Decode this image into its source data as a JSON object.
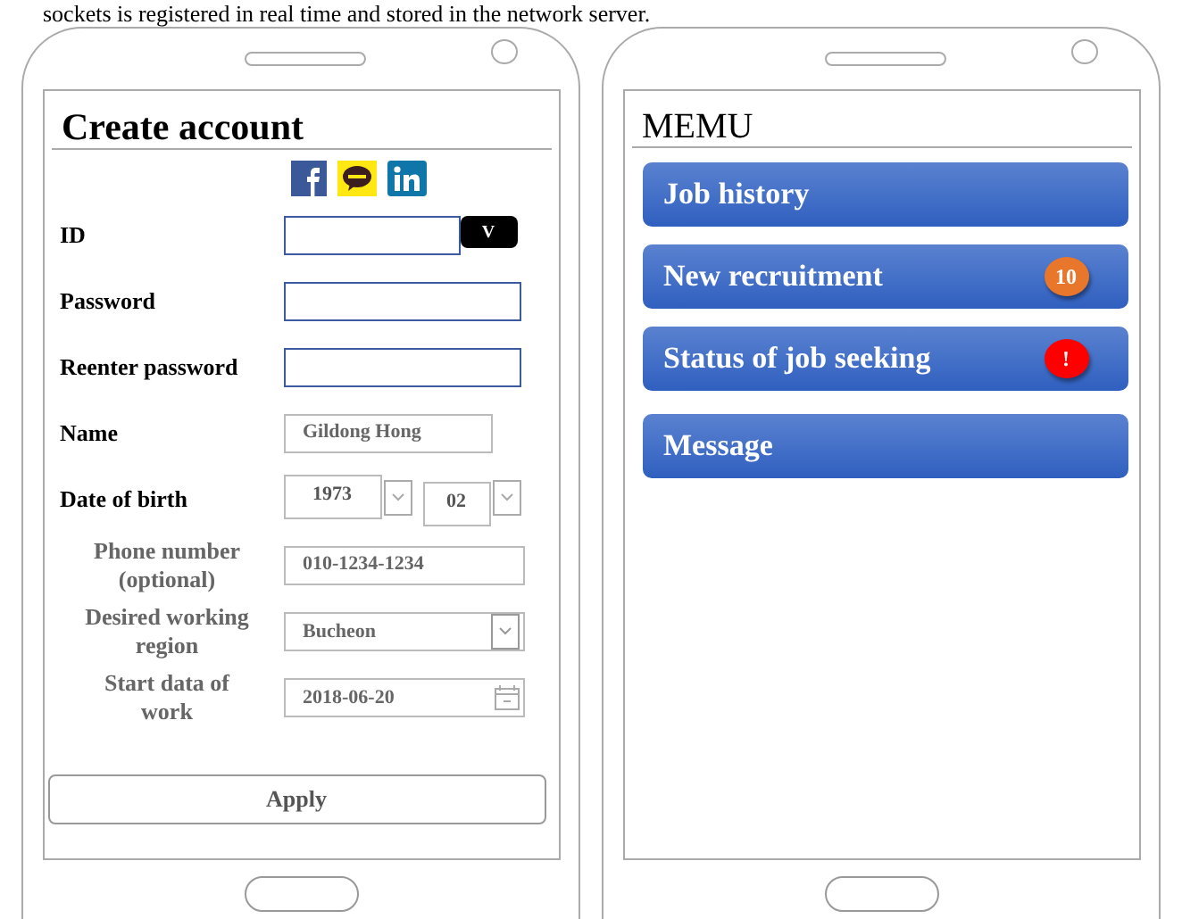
{
  "caption": "sockets is registered in real time and stored in the network server.",
  "signup": {
    "title": "Create account",
    "fields": [
      {
        "kind": "id",
        "label": "ID",
        "muted": false,
        "button": "V"
      },
      {
        "kind": "input",
        "label": "Password",
        "muted": false
      },
      {
        "kind": "input",
        "label": "Reenter password",
        "muted": false
      },
      {
        "kind": "value",
        "label": "Name",
        "muted": false,
        "value": "Gildong Hong"
      },
      {
        "kind": "pair",
        "label": "Date of birth",
        "muted": false,
        "selects": [
          "1973",
          "02"
        ]
      },
      {
        "kind": "value",
        "label": "Phone number (optional)",
        "muted": true,
        "value": "010-1234-1234"
      },
      {
        "kind": "select",
        "label": "Desired working region",
        "muted": true,
        "value": "Bucheon"
      },
      {
        "kind": "date",
        "label": "Start data of work",
        "muted": true,
        "value": "2018-06-20"
      }
    ],
    "apply": "Apply"
  },
  "menu": {
    "title": "MEMU",
    "items": [
      {
        "label": "Job history"
      },
      {
        "label": "New recruitment",
        "badge": "10",
        "color": "#e8772c"
      },
      {
        "label": "Status of job seeking",
        "badge": "!",
        "color": "#ff0000"
      },
      {
        "label": "Message"
      }
    ]
  }
}
